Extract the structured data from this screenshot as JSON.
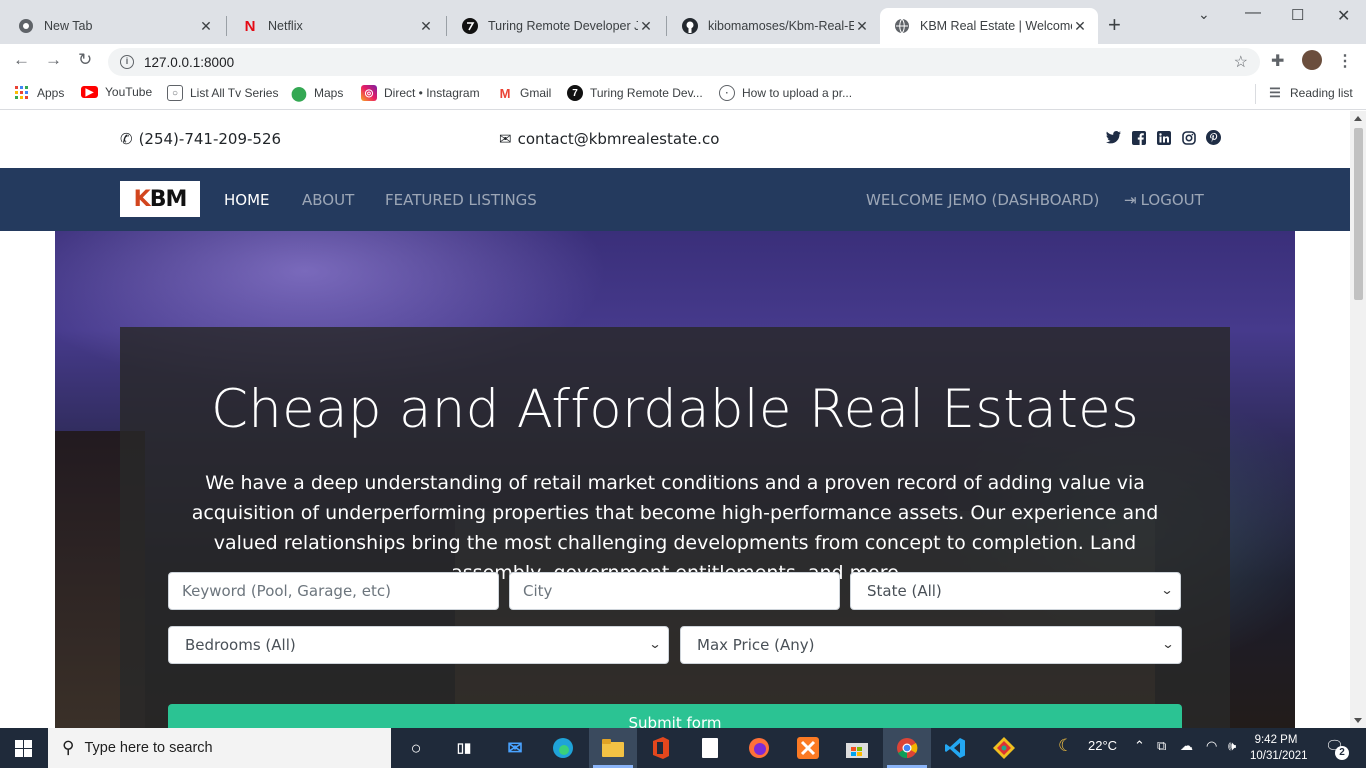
{
  "browser": {
    "tabs": [
      {
        "label": "New Tab",
        "icon": "chrome-icon"
      },
      {
        "label": "Netflix",
        "icon": "netflix-icon"
      },
      {
        "label": "Turing Remote Developer Jobs",
        "icon": "turing-icon"
      },
      {
        "label": "kibomamoses/Kbm-Real-Estate",
        "icon": "github-icon"
      },
      {
        "label": "KBM Real Estate | Welcome",
        "icon": "globe-icon"
      }
    ],
    "url": "127.0.0.1:8000",
    "bookmarks": [
      {
        "label": "Apps",
        "icon": "apps-grid-icon"
      },
      {
        "label": "YouTube",
        "icon": "youtube-icon"
      },
      {
        "label": "List All Tv Series",
        "icon": "tv-icon"
      },
      {
        "label": "Maps",
        "icon": "maps-pin-icon"
      },
      {
        "label": "Direct • Instagram",
        "icon": "instagram-icon"
      },
      {
        "label": "Gmail",
        "icon": "gmail-icon"
      },
      {
        "label": "Turing Remote Dev...",
        "icon": "turing-icon"
      },
      {
        "label": "How to upload a pr...",
        "icon": "globe-icon"
      }
    ],
    "reading_list": "Reading list"
  },
  "site": {
    "phone": "(254)-741-209-526",
    "email": "contact@kbmrealestate.co",
    "social": [
      "twitter-icon",
      "facebook-icon",
      "linkedin-icon",
      "instagram-icon",
      "pinterest-icon"
    ],
    "logo_text": "KBM",
    "nav": {
      "home": "HOME",
      "about": "ABOUT",
      "featured": "FEATURED LISTINGS",
      "welcome": "WELCOME JEMO (DASHBOARD)",
      "logout": "LOGOUT"
    },
    "hero": {
      "title": "Cheap and Affordable Real Estates",
      "text": "We have a deep understanding of retail market conditions and a proven record of adding value via acquisition of underperforming properties that become high-performance assets. Our experience and valued relationships bring the most challenging developments from concept to completion. Land assembly, government entitlements, and more"
    },
    "form": {
      "keyword_placeholder": "Keyword (Pool, Garage, etc)",
      "city_placeholder": "City",
      "state_selected": "State (All)",
      "bedrooms_selected": "Bedrooms (All)",
      "price_selected": "Max Price (Any)",
      "submit": "Submit form"
    }
  },
  "taskbar": {
    "search_placeholder": "Type here to search",
    "temperature": "22°C",
    "time": "9:42 PM",
    "date": "10/31/2021",
    "notifications": "2"
  },
  "colors": {
    "navbar": "#243a5e",
    "submit": "#2bc393",
    "taskbar": "#1f2a3a"
  }
}
